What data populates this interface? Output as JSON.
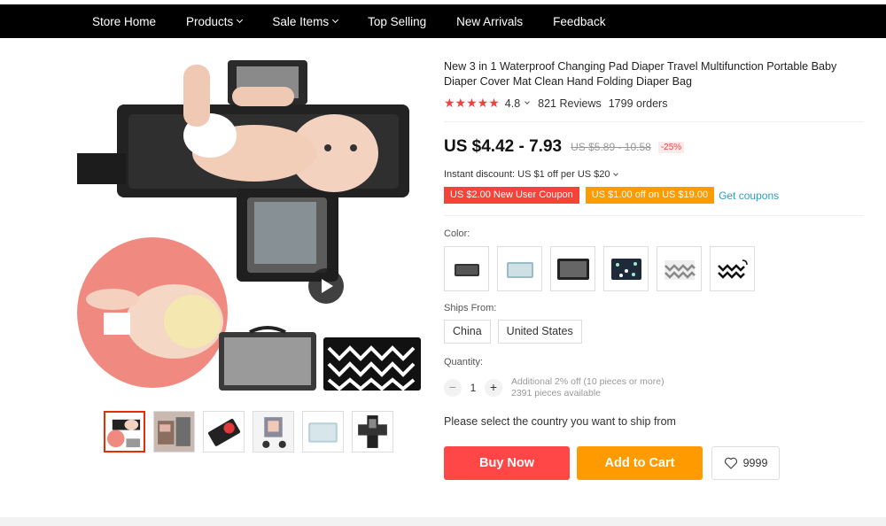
{
  "nav": {
    "items": [
      {
        "label": "Store Home",
        "has_dropdown": false
      },
      {
        "label": "Products",
        "has_dropdown": true
      },
      {
        "label": "Sale Items",
        "has_dropdown": true
      },
      {
        "label": "Top Selling",
        "has_dropdown": false
      },
      {
        "label": "New Arrivals",
        "has_dropdown": false
      },
      {
        "label": "Feedback",
        "has_dropdown": false
      }
    ]
  },
  "product": {
    "title": "New 3 in 1 Waterproof Changing Pad Diaper Travel Multifunction Portable Baby Diaper Cover Mat Clean Hand Folding Diaper Bag",
    "stars": "★★★★★",
    "rating": "4.8",
    "reviews": "821 Reviews",
    "orders": "1799 orders",
    "price": "US $4.42 - 7.93",
    "original_price": "US $5.89 - 10.58",
    "discount": "-25%",
    "instant_discount": "Instant discount: US $1 off per US $20",
    "coupons": [
      {
        "label": "US $2.00 New User Coupon",
        "color": "#f4443a"
      },
      {
        "label": "US $1.00 off on US $19.00",
        "color": "#ff9a00"
      }
    ],
    "get_coupons": "Get coupons",
    "color_label": "Color:",
    "color_options": [
      "black-pad",
      "gray-blue-pad",
      "dark-gray-pad",
      "floral-navy-pad",
      "gray-chevron-pad",
      "black-chevron-pad"
    ],
    "ships_from_label": "Ships From:",
    "ships_from": [
      "China",
      "United States"
    ],
    "quantity_label": "Quantity:",
    "quantity": "1",
    "qty_minus": "−",
    "qty_plus": "+",
    "qty_note_1": "Additional 2% off (10 pieces or more)",
    "qty_note_2": "2391 pieces available",
    "ship_message": "Please select the country you want to ship from",
    "buy_now": "Buy Now",
    "add_to_cart": "Add to Cart",
    "wishlist_count": "9999"
  },
  "colors": {
    "accent_red": "#ff4747",
    "accent_orange": "#ff9a00",
    "link_blue": "#2e9cc3",
    "nav_bg": "#000000"
  },
  "gallery": {
    "thumbnails": [
      "main-photo",
      "bag-open",
      "pad-on-table",
      "stroller",
      "folded-pad",
      "pad-spread"
    ],
    "active_index": 0
  }
}
